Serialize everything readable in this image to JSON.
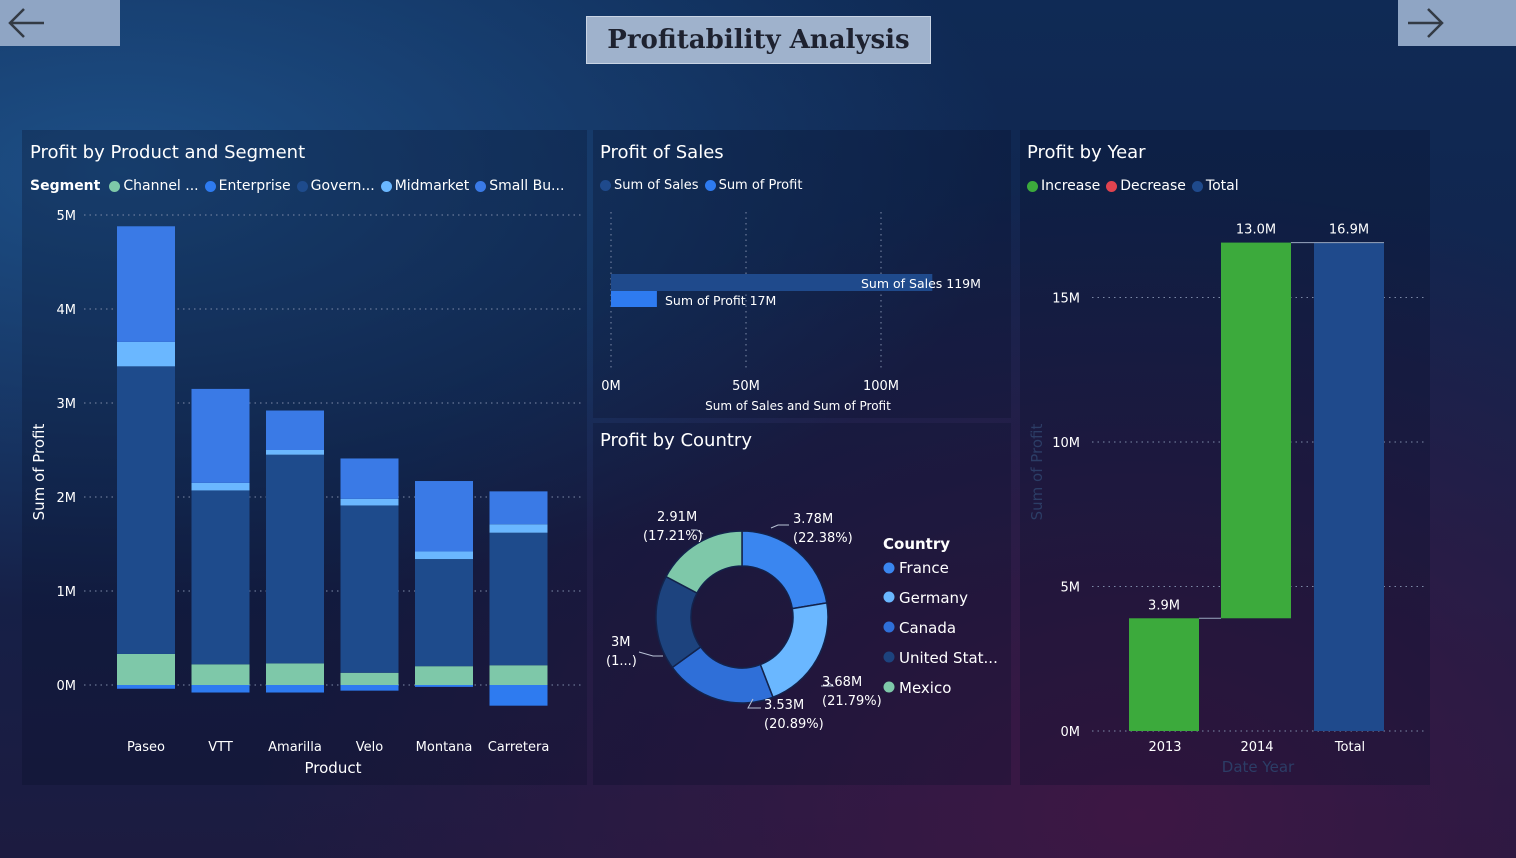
{
  "page_title": "Profitability Analysis",
  "nav": {
    "back_icon": "arrow-left-icon",
    "forward_icon": "arrow-right-icon"
  },
  "colors": {
    "channel_partners": "#7ec8a9",
    "enterprise": "#2e7bf0",
    "government": "#1e4b8c",
    "midmarket": "#6ab7ff",
    "small_business": "#3a7ae6",
    "increase": "#3caa3c",
    "decrease": "#e0434f",
    "total": "#1f4a8c"
  },
  "segment_chart": {
    "title": "Profit by Product and Segment",
    "legend_title": "Segment",
    "legend": [
      "Channel ...",
      "Enterprise",
      "Govern...",
      "Midmarket",
      "Small Bu..."
    ],
    "ylabel": "Sum of Profit",
    "xlabel": "Product",
    "yticks": [
      "5M",
      "4M",
      "3M",
      "2M",
      "1M",
      "0M"
    ]
  },
  "sales_chart": {
    "title": "Profit of Sales",
    "legend": [
      "Sum of  Sales",
      "Sum of Profit"
    ],
    "bar1_label": "Sum of Sales 119M",
    "bar2_label": "Sum of Profit 17M",
    "xticks": [
      "0M",
      "50M",
      "100M"
    ],
    "xlabel": "Sum of Sales and Sum of Profit"
  },
  "country_chart": {
    "title": "Profit by Country",
    "legend_title": "Country",
    "legend": [
      "France",
      "Germany",
      "Canada",
      "United Stat...",
      "Mexico"
    ],
    "labels": {
      "france_v": "3.78M",
      "france_p": "(22.38%)",
      "germany_v": "3.68M",
      "germany_p": "(21.79%)",
      "canada_v": "3.53M",
      "canada_p": "(20.89%)",
      "us_v": "3M",
      "us_p": "(1...)",
      "mexico_v": "2.91M",
      "mexico_p": "(17.21%)"
    }
  },
  "year_chart": {
    "title": "Profit by Year",
    "legend": [
      "Increase",
      "Decrease",
      "Total"
    ],
    "ylabel": "Sum of Profit",
    "xlabel": "Date Year",
    "yticks": [
      "15M",
      "10M",
      "5M",
      "0M"
    ],
    "labels": [
      "3.9M",
      "13.0M",
      "16.9M"
    ]
  },
  "chart_data": [
    {
      "type": "bar",
      "title": "Profit by Product and Segment",
      "xlabel": "Product",
      "ylabel": "Sum of Profit",
      "ylim": [
        0,
        5000000
      ],
      "stacked": true,
      "categories": [
        "Paseo",
        "VTT",
        "Amarilla",
        "Velo",
        "Montana",
        "Carretera"
      ],
      "series": [
        {
          "name": "Channel ...",
          "values": [
            330000,
            220000,
            230000,
            130000,
            200000,
            210000
          ]
        },
        {
          "name": "Enterprise",
          "values": [
            -40000,
            -80000,
            -80000,
            -60000,
            -20000,
            -220000
          ]
        },
        {
          "name": "Govern...",
          "values": [
            3060000,
            1850000,
            2220000,
            1780000,
            1140000,
            1410000
          ]
        },
        {
          "name": "Midmarket",
          "values": [
            260000,
            80000,
            50000,
            70000,
            80000,
            90000
          ]
        },
        {
          "name": "Small Bu...",
          "values": [
            1230000,
            1000000,
            420000,
            430000,
            750000,
            350000
          ]
        }
      ]
    },
    {
      "type": "bar",
      "orientation": "horizontal",
      "title": "Profit of Sales",
      "xlabel": "Sum of Sales and Sum of Profit",
      "xlim": [
        0,
        140000000
      ],
      "categories": [
        "Sum of  Sales",
        "Sum of Profit"
      ],
      "values": [
        119000000,
        17000000
      ]
    },
    {
      "type": "pie",
      "title": "Profit by Country",
      "donut": true,
      "categories": [
        "France",
        "Germany",
        "Canada",
        "United Stat...",
        "Mexico"
      ],
      "values": [
        3780000,
        3680000,
        3530000,
        3000000,
        2910000
      ],
      "percent": [
        22.38,
        21.79,
        20.89,
        17.73,
        17.21
      ]
    },
    {
      "type": "bar",
      "subtype": "waterfall",
      "title": "Profit by Year",
      "xlabel": "Date Year",
      "ylabel": "Sum of Profit",
      "ylim": [
        0,
        20000000
      ],
      "categories": [
        "2013",
        "2014",
        "Total"
      ],
      "values": [
        3900000,
        13000000,
        16900000
      ],
      "kind": [
        "Increase",
        "Increase",
        "Total"
      ]
    }
  ]
}
